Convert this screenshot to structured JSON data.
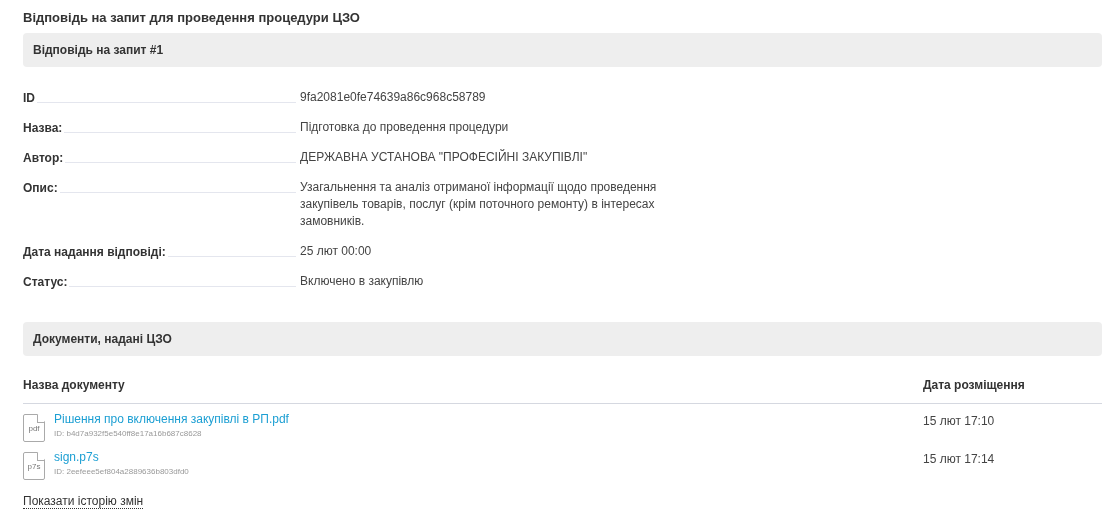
{
  "title": "Відповідь на запит для проведення процедури ЦЗО",
  "response_section": {
    "heading": "Відповідь на запит #1",
    "fields": [
      {
        "label": "ID",
        "value": "9fa2081e0fe74639a86c968c58789"
      },
      {
        "label": "Назва:",
        "value": "Підготовка до проведення процедури"
      },
      {
        "label": "Автор:",
        "value": "ДЕРЖАВНА УСТАНОВА \"ПРОФЕСІЙНІ ЗАКУПІВЛІ\""
      },
      {
        "label": "Опис:",
        "value": "Узагальнення та аналіз отриманої інформації щодо проведення закупівель товарів, послуг (крім поточного ремонту) в інтересах замовників."
      },
      {
        "label": "Дата надання відповіді:",
        "value": "25 лют 00:00"
      },
      {
        "label": "Статус:",
        "value": "Включено в закупівлю"
      }
    ]
  },
  "documents_section": {
    "heading": "Документи, надані ЦЗО",
    "columns": [
      "Назва документу",
      "Дата розміщення"
    ],
    "documents": [
      {
        "type": "pdf",
        "name": "Рішення про включення закупівлі в РП.pdf",
        "id": "ID: b4d7a932f5e540ff8e17a16b687c8628",
        "date": "15 лют 17:10"
      },
      {
        "type": "p7s",
        "name": "sign.p7s",
        "id": "ID: 2eefeee5ef804a2889636b803dfd0",
        "date": "15 лют 17:14"
      }
    ]
  },
  "history_link": "Показати історію змін"
}
